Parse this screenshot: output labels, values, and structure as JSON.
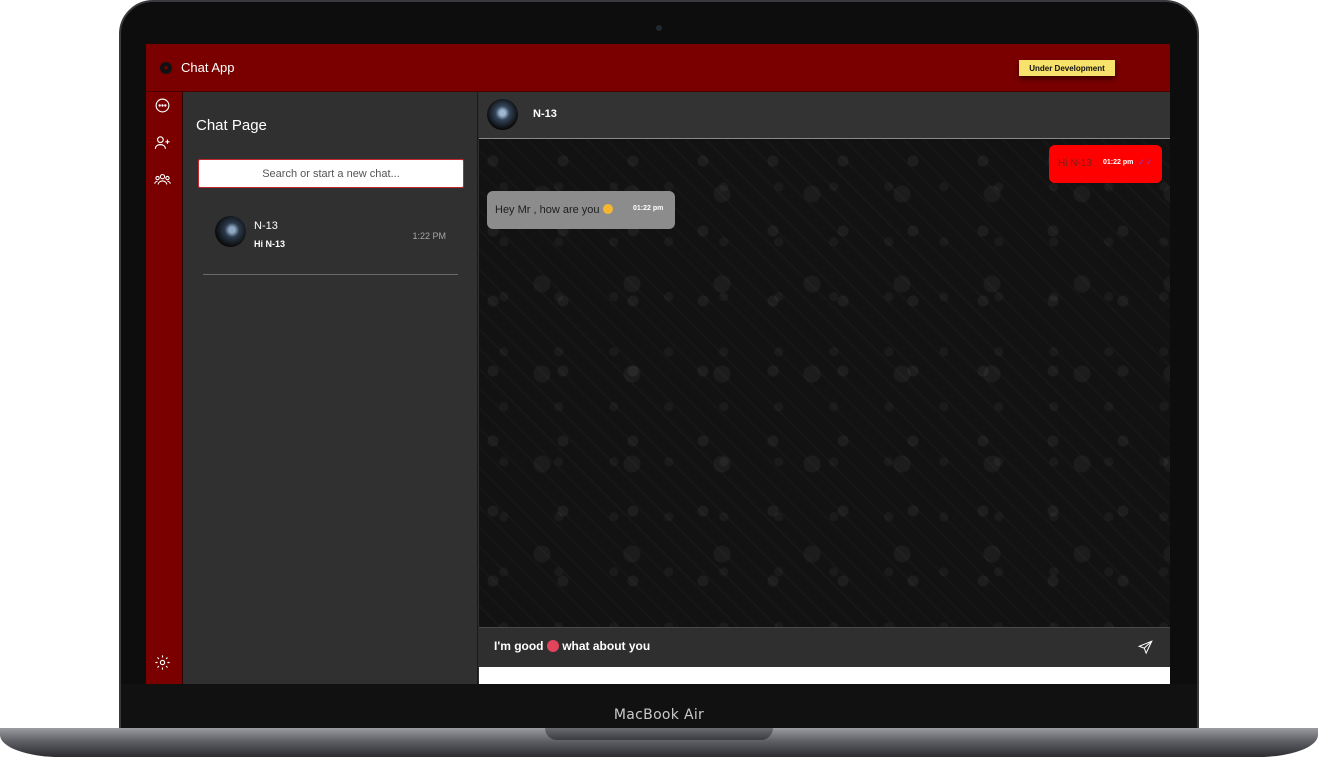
{
  "device": {
    "label": "MacBook Air"
  },
  "app": {
    "title": "Chat App",
    "badge": "Under Development"
  },
  "rail": {
    "icons": [
      "chat-bubble-icon",
      "add-user-icon",
      "group-icon",
      "settings-gear-icon"
    ]
  },
  "chat_list": {
    "title": "Chat Page",
    "search_placeholder": "Search or start a new chat...",
    "conversations": [
      {
        "name": "N-13",
        "last_message": "Hi N-13",
        "time": "1:22 PM"
      }
    ]
  },
  "chat": {
    "contact_name": "N-13",
    "messages": [
      {
        "direction": "outgoing",
        "text": "Hi N-13",
        "time": "01:22 pm",
        "status_icon": "read-check-icon"
      },
      {
        "direction": "incoming",
        "text": "Hey Mr , how are you",
        "emoji": "grinning-face-icon",
        "time": "01:22 pm"
      }
    ],
    "composer_text": "I'm good",
    "composer_text_tail": "what about you",
    "composer_emoji": "star-struck-face-icon",
    "send_icon": "send-icon"
  },
  "colors": {
    "brand": "#7a0000",
    "outgoing_bubble": "#ff0000",
    "incoming_bubble": "#8c8c8c",
    "badge": "#f7e26b"
  }
}
